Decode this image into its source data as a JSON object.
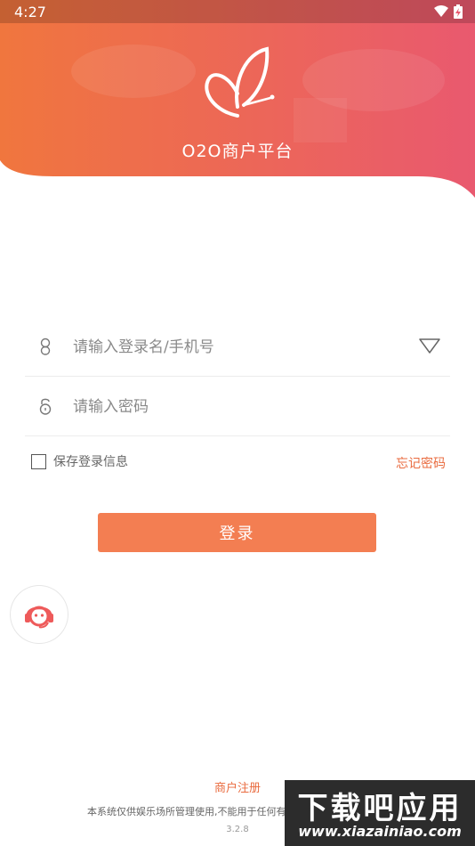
{
  "status_bar": {
    "time": "4:27",
    "icons": [
      "wifi-icon",
      "battery-charging-icon"
    ]
  },
  "header": {
    "app_title": "O2O商户平台",
    "logo_icon": "butterfly-logo",
    "gradient": [
      "#f0763e",
      "#e9596f"
    ]
  },
  "form": {
    "username": {
      "placeholder": "请输入登录名/手机号",
      "value": ""
    },
    "password": {
      "placeholder": "请输入密码",
      "value": ""
    },
    "remember_label": "保存登录信息",
    "remember_checked": false,
    "forgot_label": "忘记密码",
    "login_label": "登录"
  },
  "support": {
    "icon": "customer-service-icon"
  },
  "footer": {
    "register_label": "商户注册",
    "disclaimer": "本系统仅供娱乐场所管理使用,不能用于任何有",
    "version": "3.2.8"
  },
  "watermark": {
    "title": "下载吧应用",
    "url": "www.xiazainiao.com"
  },
  "colors": {
    "accent": "#f37e52",
    "link": "#e96b3f"
  }
}
